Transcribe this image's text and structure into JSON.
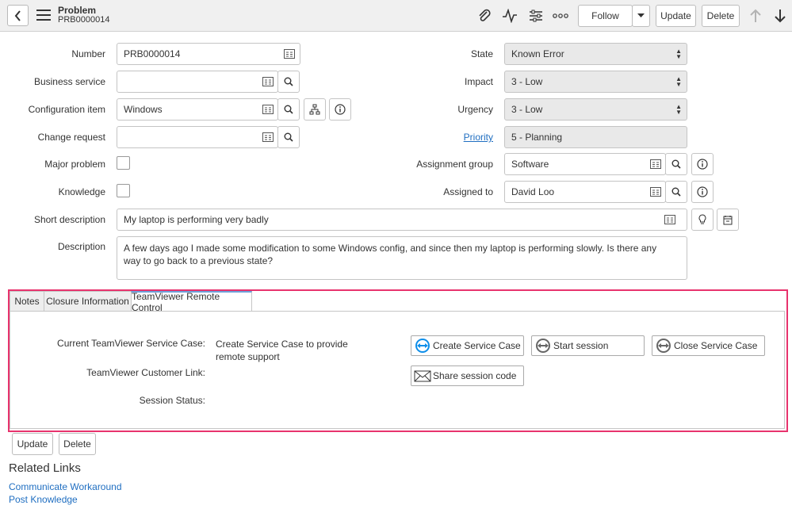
{
  "header": {
    "title": "Problem",
    "number": "PRB0000014",
    "follow_label": "Follow",
    "update_label": "Update",
    "delete_label": "Delete"
  },
  "form": {
    "number": {
      "label": "Number",
      "value": "PRB0000014"
    },
    "business_service": {
      "label": "Business service",
      "value": ""
    },
    "configuration_item": {
      "label": "Configuration item",
      "value": "Windows"
    },
    "change_request": {
      "label": "Change request",
      "value": ""
    },
    "major_problem": {
      "label": "Major problem"
    },
    "knowledge": {
      "label": "Knowledge"
    },
    "short_description": {
      "label": "Short description",
      "value": "My laptop is performing very badly"
    },
    "description": {
      "label": "Description",
      "value": "A few days ago I made some modification to some Windows config, and since then my laptop is performing slowly. Is there any way to go back to a previous state?"
    },
    "state": {
      "label": "State",
      "value": "Known Error"
    },
    "impact": {
      "label": "Impact",
      "value": "3 - Low"
    },
    "urgency": {
      "label": "Urgency",
      "value": "3 - Low"
    },
    "priority": {
      "label": "Priority",
      "value": "5 - Planning"
    },
    "assignment_group": {
      "label": "Assignment group",
      "value": "Software"
    },
    "assigned_to": {
      "label": "Assigned to",
      "value": "David Loo"
    }
  },
  "tabs": [
    "Notes",
    "Closure Information",
    "TeamViewer Remote Control"
  ],
  "teamviewer": {
    "case_label": "Current TeamViewer Service Case:",
    "case_value": "Create Service Case to provide remote support",
    "link_label": "TeamViewer Customer Link:",
    "status_label": "Session Status:",
    "create_btn": "Create Service Case",
    "start_btn": "Start session",
    "close_btn": "Close Service Case",
    "share_btn": "Share session code"
  },
  "footer": {
    "update_label": "Update",
    "delete_label": "Delete"
  },
  "related_links": {
    "title": "Related Links",
    "items": [
      "Communicate Workaround",
      "Post Knowledge"
    ]
  },
  "colors": {
    "highlight": "#e8336d",
    "link": "#1f6ec1",
    "accent_tab": "#6fa1d9"
  }
}
